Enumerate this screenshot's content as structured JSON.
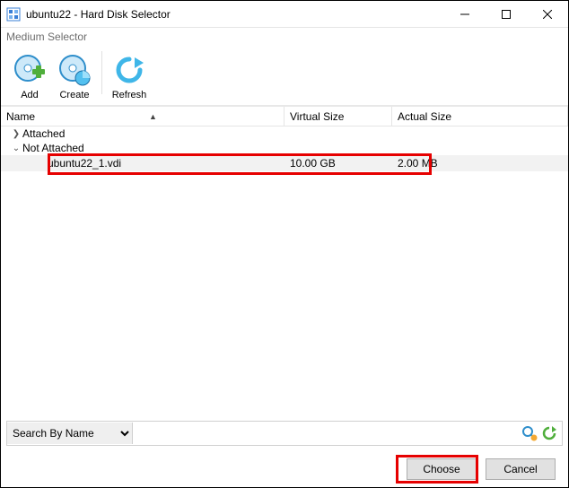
{
  "window": {
    "title": "ubuntu22 - Hard Disk Selector"
  },
  "menubar": {
    "medium_selector": "Medium Selector"
  },
  "toolbar": {
    "add": "Add",
    "create": "Create",
    "refresh": "Refresh"
  },
  "columns": {
    "name": "Name",
    "virtual_size": "Virtual Size",
    "actual_size": "Actual Size"
  },
  "tree": {
    "attached": "Attached",
    "not_attached": "Not Attached"
  },
  "file": {
    "name": "ubuntu22_1.vdi",
    "virtual_size": "10.00 GB",
    "actual_size": "2.00 MB"
  },
  "search": {
    "mode": "Search By Name",
    "value": ""
  },
  "buttons": {
    "choose": "Choose",
    "cancel": "Cancel"
  }
}
